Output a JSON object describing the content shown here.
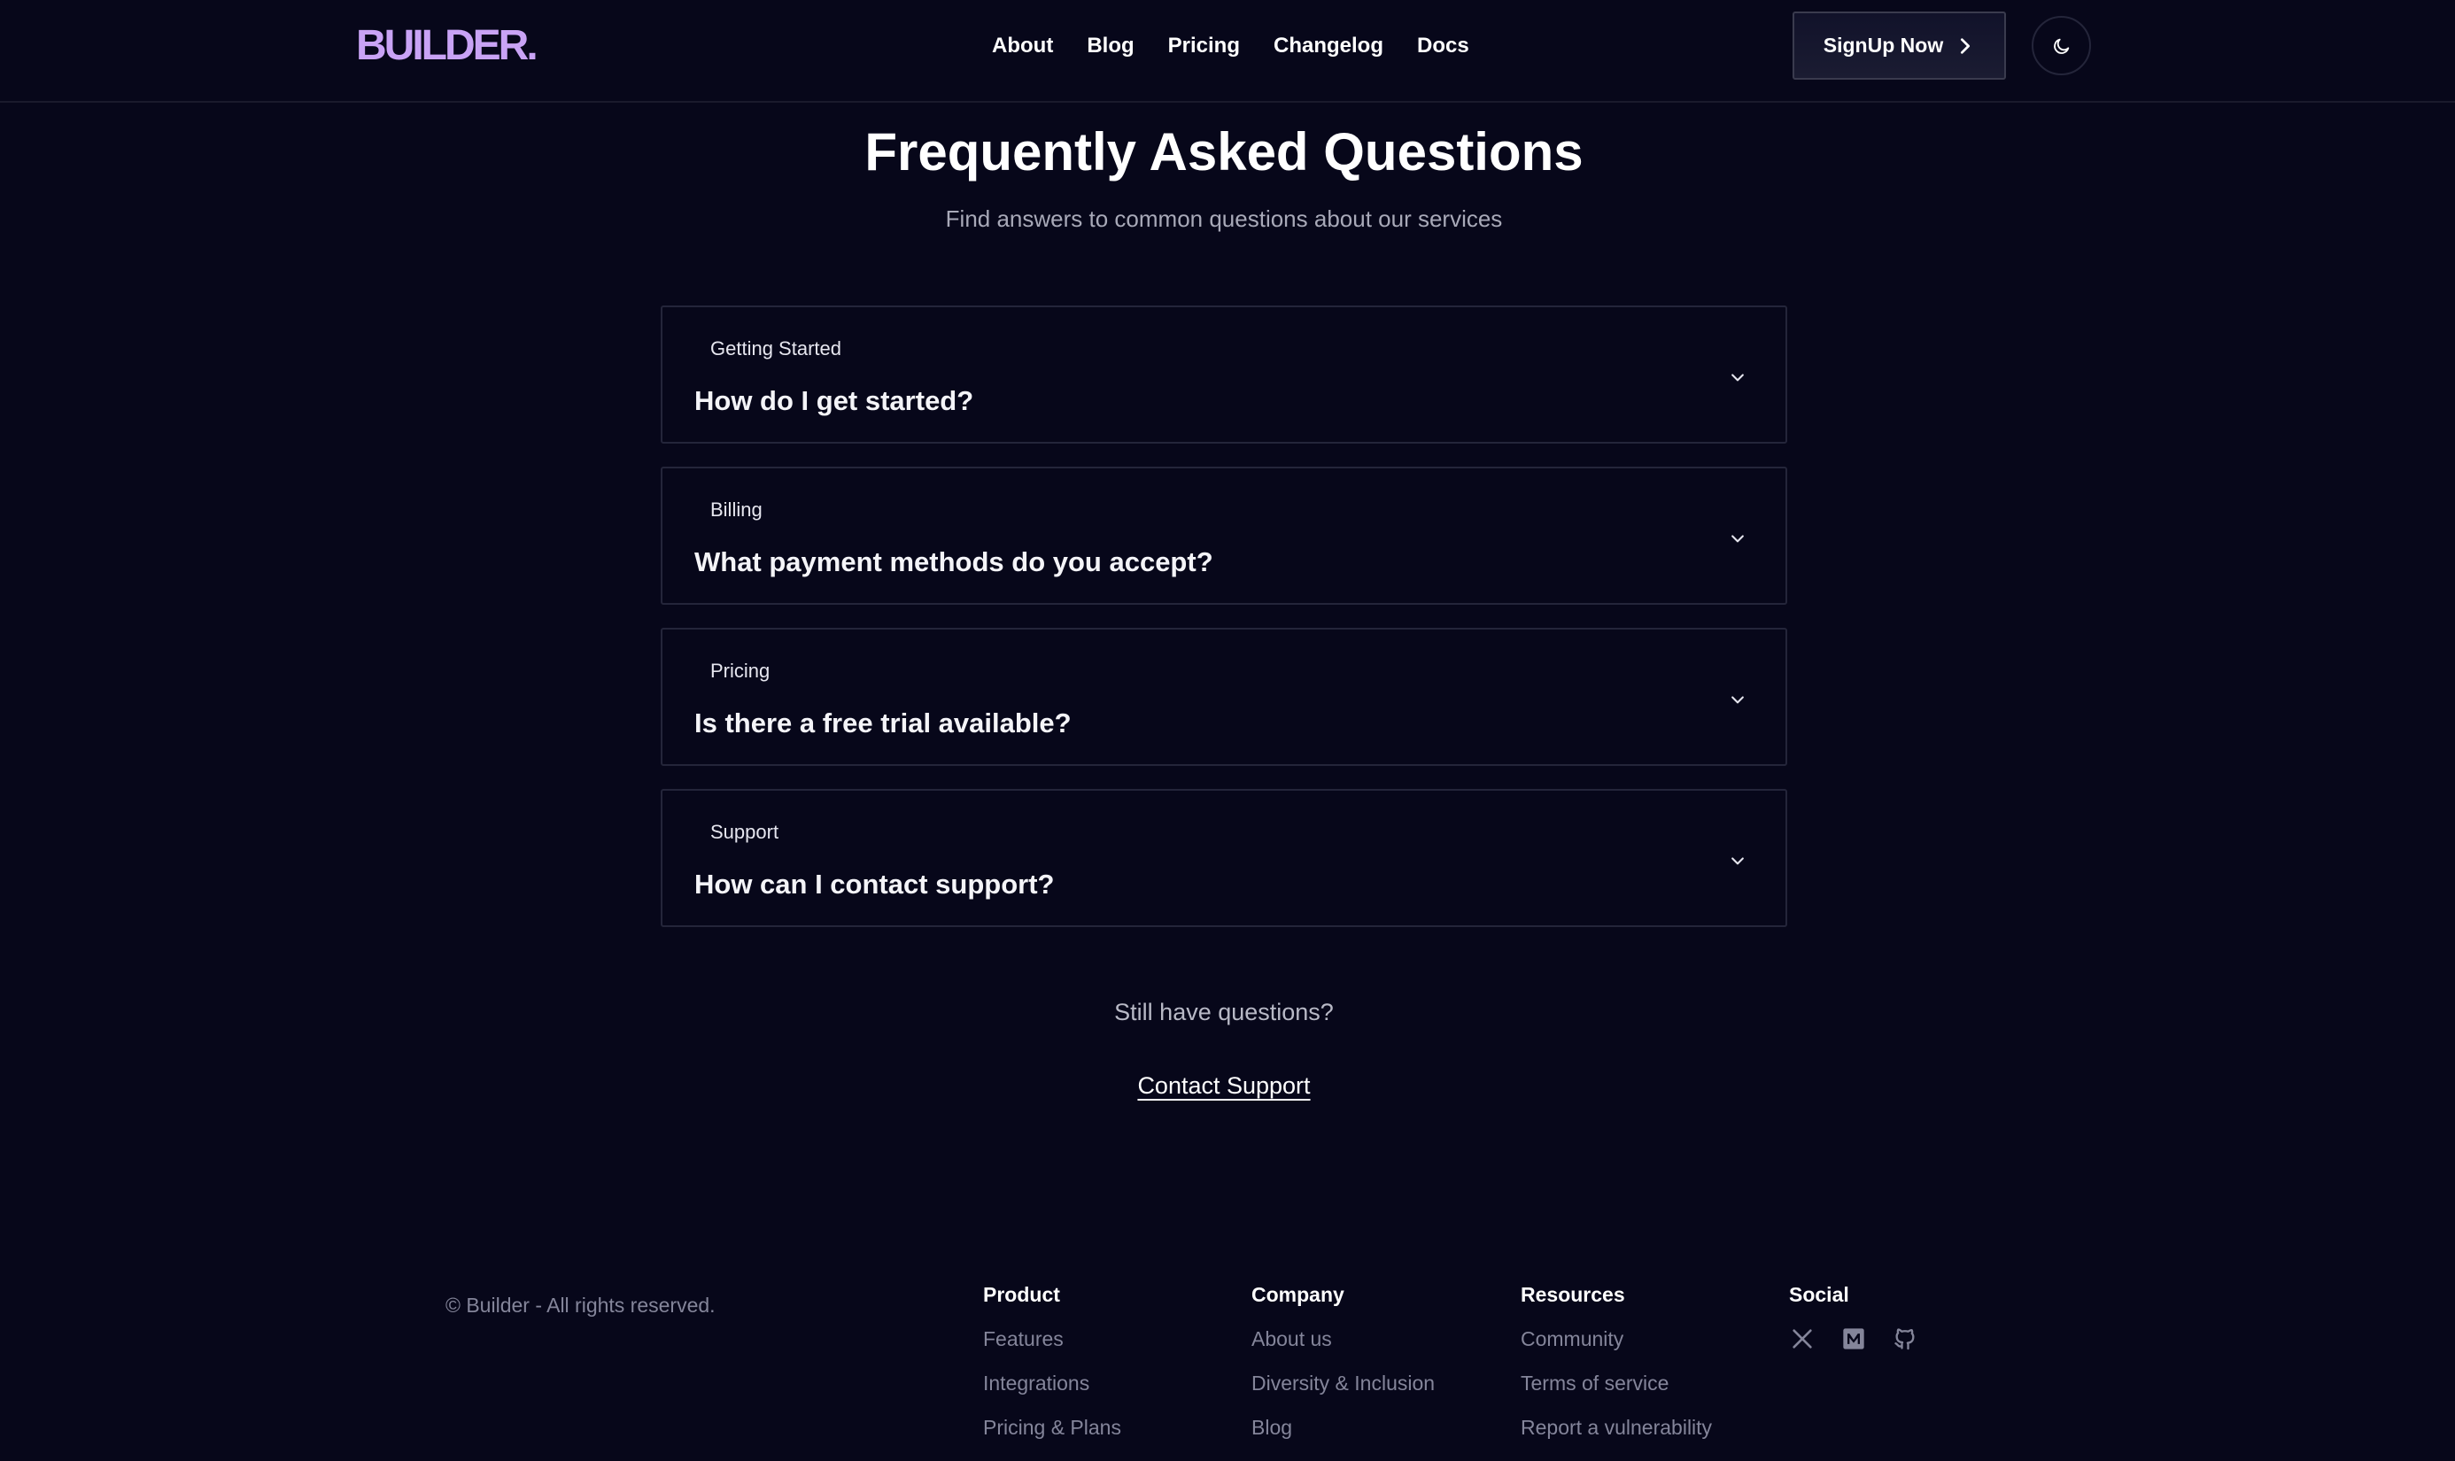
{
  "header": {
    "logo": "BUILDER.",
    "nav": [
      "About",
      "Blog",
      "Pricing",
      "Changelog",
      "Docs"
    ],
    "signup_label": "SignUp Now",
    "theme_icon": "moon-icon"
  },
  "faq": {
    "title": "Frequently Asked Questions",
    "subtitle": "Find answers to common questions about our services",
    "items": [
      {
        "category": "Getting Started",
        "question": "How do I get started?"
      },
      {
        "category": "Billing",
        "question": "What payment methods do you accept?"
      },
      {
        "category": "Pricing",
        "question": "Is there a free trial available?"
      },
      {
        "category": "Support",
        "question": "How can I contact support?"
      }
    ]
  },
  "support": {
    "prompt": "Still have questions?",
    "link_label": "Contact Support"
  },
  "footer": {
    "copyright": "© Builder - All rights reserved.",
    "columns": [
      {
        "title": "Product",
        "links": [
          "Features",
          "Integrations",
          "Pricing & Plans"
        ]
      },
      {
        "title": "Company",
        "links": [
          "About us",
          "Diversity & Inclusion",
          "Blog"
        ]
      },
      {
        "title": "Resources",
        "links": [
          "Community",
          "Terms of service",
          "Report a vulnerability"
        ]
      }
    ],
    "social": {
      "title": "Social",
      "icons": [
        "x-icon",
        "medium-icon",
        "github-icon"
      ]
    }
  },
  "colors": {
    "background": "#07071a",
    "logo": "#c9a3f5",
    "muted_text": "#84859a",
    "border": "#24253a"
  }
}
